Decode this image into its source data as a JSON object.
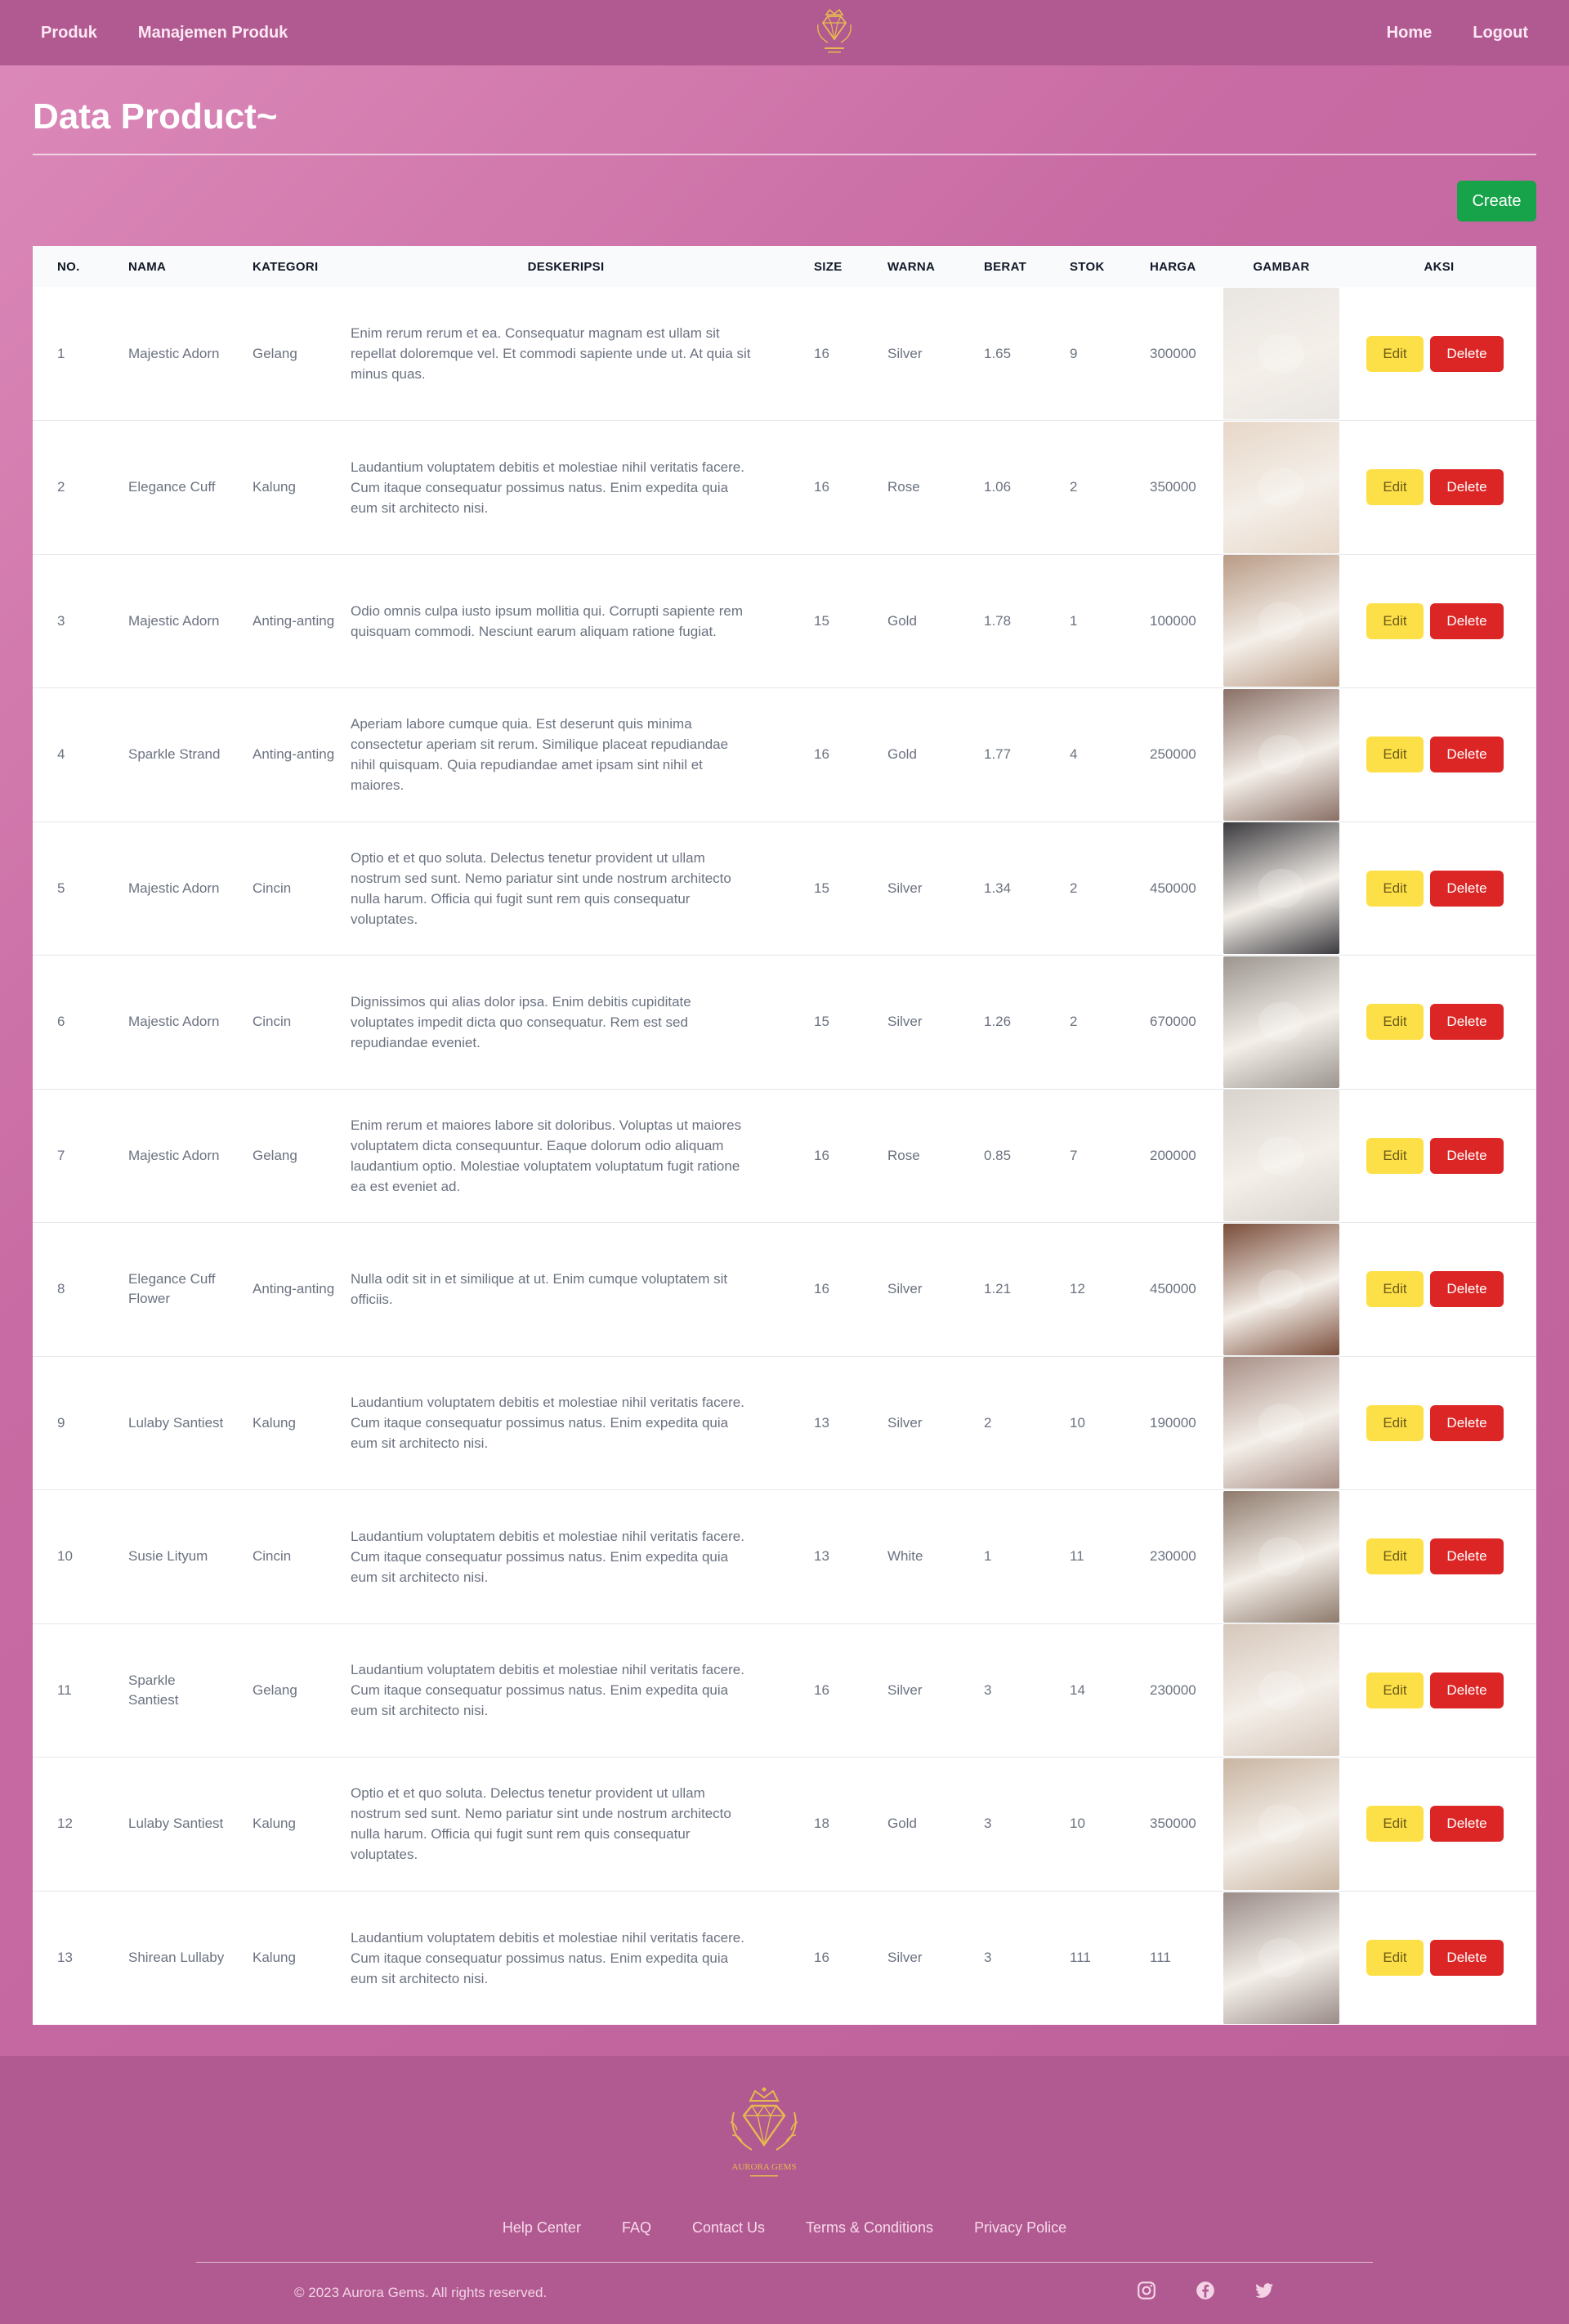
{
  "navbar": {
    "left_links": [
      "Produk",
      "Manajemen Produk"
    ],
    "right_links": [
      "Home",
      "Logout"
    ],
    "logo_icon": "aurora-gems-crown-diamond-logo"
  },
  "page": {
    "title": "Data Product~",
    "create_label": "Create"
  },
  "table": {
    "headers": [
      "No.",
      "Nama",
      "Kategori",
      "Deskeripsi",
      "Size",
      "Warna",
      "Berat",
      "Stok",
      "Harga",
      "Gambar",
      "Aksi"
    ],
    "edit_label": "Edit",
    "delete_label": "Delete",
    "rows": [
      {
        "no": "1",
        "nama": "Majestic Adorn",
        "kategori": "Gelang",
        "deskripsi": "Enim rerum rerum et ea. Consequatur magnam est ullam sit repellat doloremque vel. Et commodi sapiente unde ut. At quia sit minus quas.",
        "size": "16",
        "warna": "Silver",
        "berat": "1.65",
        "stok": "9",
        "harga": "300000",
        "image_tone": "#e9e5e1"
      },
      {
        "no": "2",
        "nama": "Elegance Cuff",
        "kategori": "Kalung",
        "deskripsi": "Laudantium voluptatem debitis et molestiae nihil veritatis facere. Cum itaque consequatur possimus natus. Enim expedita quia eum sit architecto nisi.",
        "size": "16",
        "warna": "Rose",
        "berat": "1.06",
        "stok": "2",
        "harga": "350000",
        "image_tone": "#e7d7c8"
      },
      {
        "no": "3",
        "nama": "Majestic Adorn",
        "kategori": "Anting-anting",
        "deskripsi": "Odio omnis culpa iusto ipsum mollitia qui. Corrupti sapiente rem quisquam commodi. Nesciunt earum aliquam ratione fugiat.",
        "size": "15",
        "warna": "Gold",
        "berat": "1.78",
        "stok": "1",
        "harga": "100000",
        "image_tone": "#b99b86"
      },
      {
        "no": "4",
        "nama": "Sparkle Strand",
        "kategori": "Anting-anting",
        "deskripsi": "Aperiam labore cumque quia. Est deserunt quis minima consectetur aperiam sit rerum. Similique placeat repudiandae nihil quisquam. Quia repudiandae amet ipsam sint nihil et maiores.",
        "size": "16",
        "warna": "Gold",
        "berat": "1.77",
        "stok": "4",
        "harga": "250000",
        "image_tone": "#8a7066"
      },
      {
        "no": "5",
        "nama": "Majestic Adorn",
        "kategori": "Cincin",
        "deskripsi": "Optio et et quo soluta. Delectus tenetur provident ut ullam nostrum sed sunt. Nemo pariatur sint unde nostrum architecto nulla harum. Officia qui fugit sunt rem quis consequatur voluptates.",
        "size": "15",
        "warna": "Silver",
        "berat": "1.34",
        "stok": "2",
        "harga": "450000",
        "image_tone": "#3b3a3e"
      },
      {
        "no": "6",
        "nama": "Majestic Adorn",
        "kategori": "Cincin",
        "deskripsi": "Dignissimos qui alias dolor ipsa. Enim debitis cupiditate voluptates impedit dicta quo consequatur. Rem est sed repudiandae eveniet.",
        "size": "15",
        "warna": "Silver",
        "berat": "1.26",
        "stok": "2",
        "harga": "670000",
        "image_tone": "#9c958f"
      },
      {
        "no": "7",
        "nama": "Majestic Adorn",
        "kategori": "Gelang",
        "deskripsi": "Enim rerum et maiores labore sit doloribus. Voluptas ut maiores voluptatem dicta consequuntur. Eaque dolorum odio aliquam laudantium optio. Molestiae voluptatem voluptatum fugit ratione ea est eveniet ad.",
        "size": "16",
        "warna": "Rose",
        "berat": "0.85",
        "stok": "7",
        "harga": "200000",
        "image_tone": "#d9d3cd"
      },
      {
        "no": "8",
        "nama": "Elegance Cuff Flower",
        "kategori": "Anting-anting",
        "deskripsi": "Nulla odit sit in et similique at ut. Enim cumque voluptatem sit officiis.",
        "size": "16",
        "warna": "Silver",
        "berat": "1.21",
        "stok": "12",
        "harga": "450000",
        "image_tone": "#7a4d3a"
      },
      {
        "no": "9",
        "nama": "Lulaby Santiest",
        "kategori": "Kalung",
        "deskripsi": "Laudantium voluptatem debitis et molestiae nihil veritatis facere. Cum itaque consequatur possimus natus. Enim expedita quia eum sit architecto nisi.",
        "size": "13",
        "warna": "Silver",
        "berat": "2",
        "stok": "10",
        "harga": "190000",
        "image_tone": "#a88f86"
      },
      {
        "no": "10",
        "nama": "Susie Lityum",
        "kategori": "Cincin",
        "deskripsi": "Laudantium voluptatem debitis et molestiae nihil veritatis facere. Cum itaque consequatur possimus natus. Enim expedita quia eum sit architecto nisi.",
        "size": "13",
        "warna": "White",
        "berat": "1",
        "stok": "11",
        "harga": "230000",
        "image_tone": "#8e7a6c"
      },
      {
        "no": "11",
        "nama": "Sparkle Santiest",
        "kategori": "Gelang",
        "deskripsi": "Laudantium voluptatem debitis et molestiae nihil veritatis facere. Cum itaque consequatur possimus natus. Enim expedita quia eum sit architecto nisi.",
        "size": "16",
        "warna": "Silver",
        "berat": "3",
        "stok": "14",
        "harga": "230000",
        "image_tone": "#d6c7bb"
      },
      {
        "no": "12",
        "nama": "Lulaby Santiest",
        "kategori": "Kalung",
        "deskripsi": "Optio et et quo soluta. Delectus tenetur provident ut ullam nostrum sed sunt. Nemo pariatur sint unde nostrum architecto nulla harum. Officia qui fugit sunt rem quis consequatur voluptates.",
        "size": "18",
        "warna": "Gold",
        "berat": "3",
        "stok": "10",
        "harga": "350000",
        "image_tone": "#c9b5a2"
      },
      {
        "no": "13",
        "nama": "Shirean Lullaby",
        "kategori": "Kalung",
        "deskripsi": "Laudantium voluptatem debitis et molestiae nihil veritatis facere. Cum itaque consequatur possimus natus. Enim expedita quia eum sit architecto nisi.",
        "size": "16",
        "warna": "Silver",
        "berat": "3",
        "stok": "111",
        "harga": "111",
        "image_tone": "#9a8c88"
      }
    ]
  },
  "footer": {
    "logo_icon": "aurora-gems-crown-diamond-logo",
    "links": [
      "Help Center",
      "FAQ",
      "Contact Us",
      "Terms & Conditions",
      "Privacy Police"
    ],
    "copyright": "© 2023 Aurora Gems. All rights reserved.",
    "socials": [
      "instagram-icon",
      "facebook-icon",
      "twitter-icon"
    ]
  },
  "colors": {
    "navbar": "#b15a91",
    "create_button": "#16a34a",
    "edit_button": "#fde047",
    "delete_button": "#dc2626",
    "logo_gold": "#e6b94f"
  }
}
